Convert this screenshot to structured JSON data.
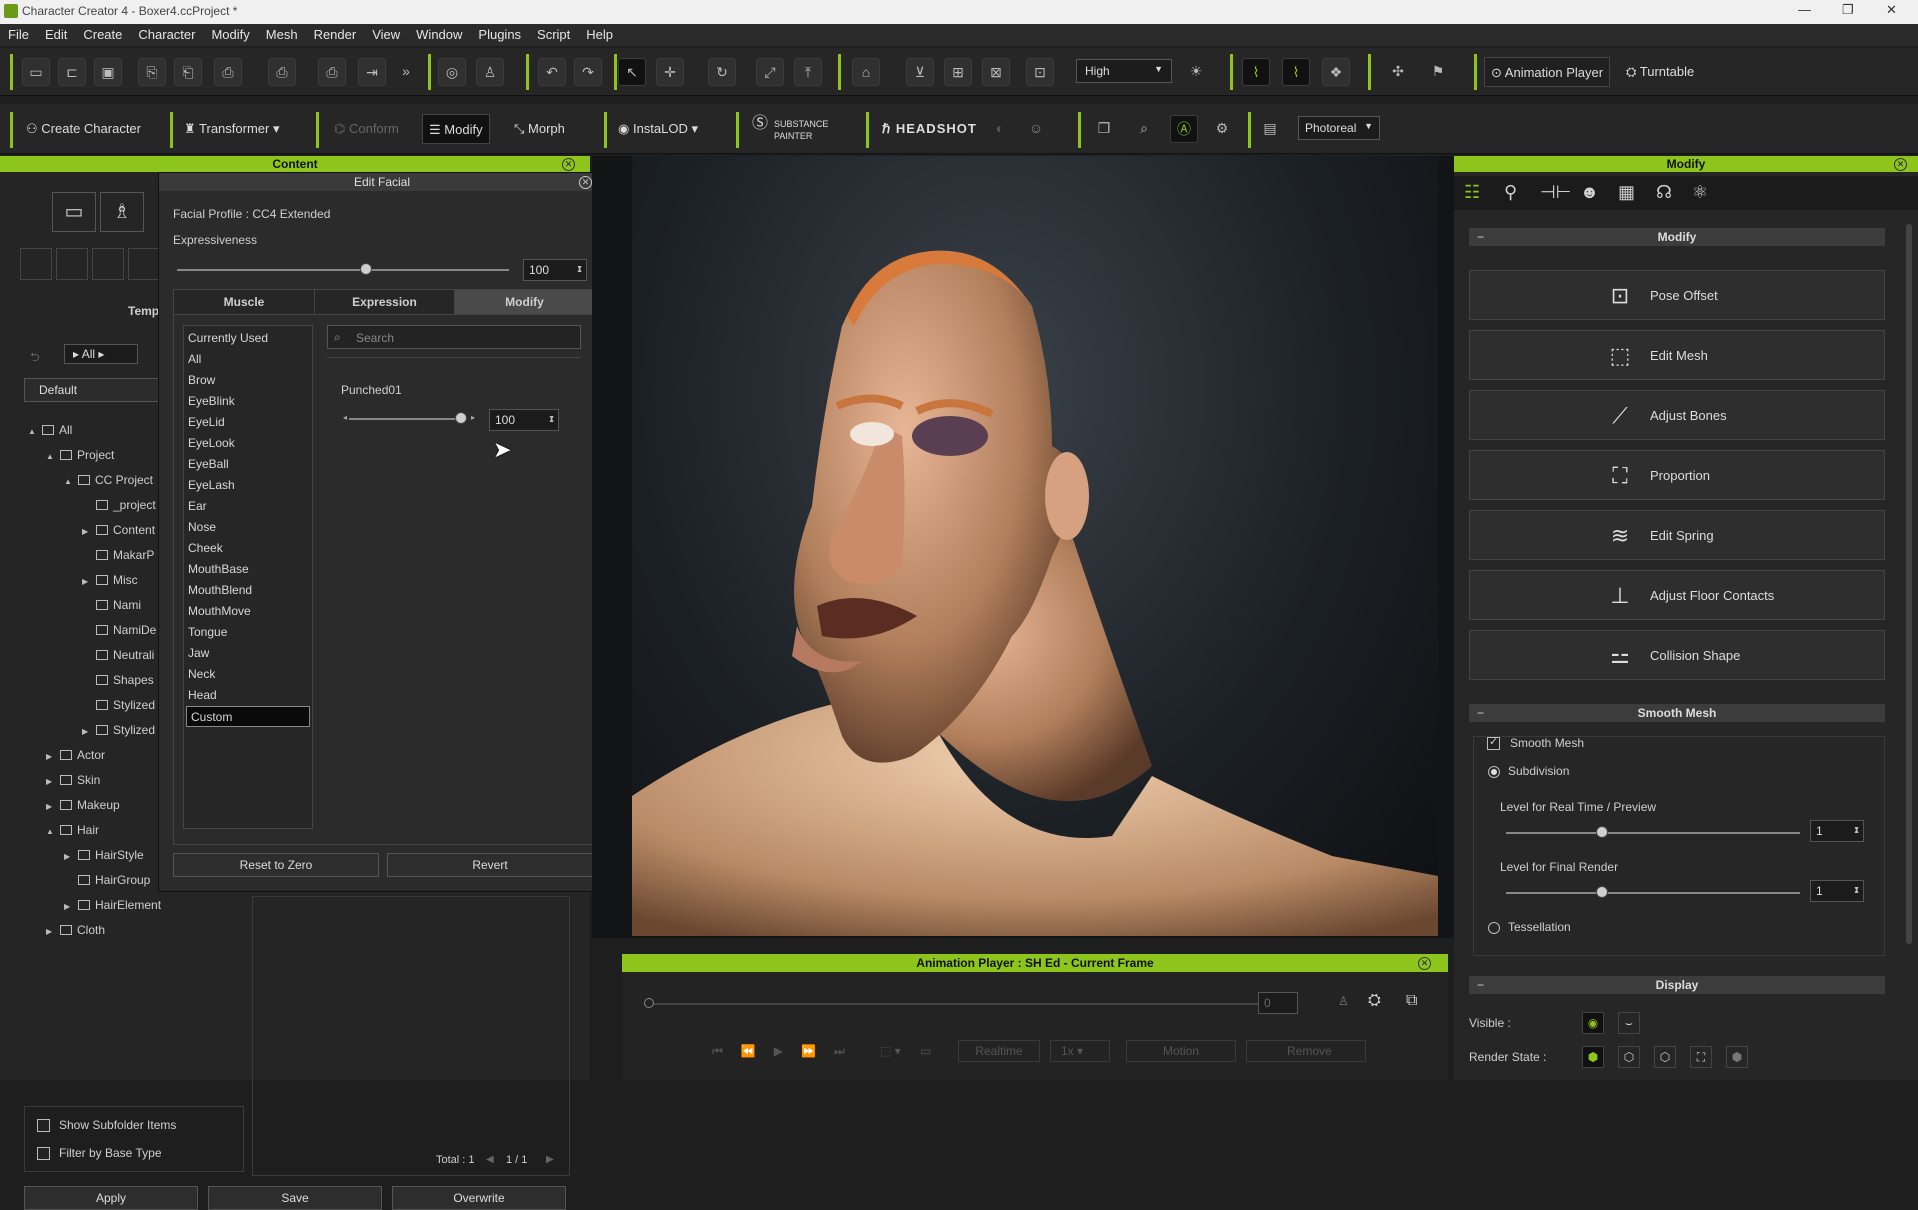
{
  "window": {
    "title": "Character Creator 4 - Boxer4.ccProject *"
  },
  "menu": [
    "File",
    "Edit",
    "Create",
    "Character",
    "Modify",
    "Mesh",
    "Render",
    "View",
    "Window",
    "Plugins",
    "Script",
    "Help"
  ],
  "toolbar": {
    "quality": "High",
    "animation_player": "Animation Player",
    "turntable": "Turntable"
  },
  "toolbar2": {
    "create_character": "Create Character",
    "transformer": "Transformer",
    "conform": "Conform",
    "modify": "Modify",
    "morph": "Morph",
    "instalod": "InstaLOD",
    "substance": "SUBSTANCE PAINTER",
    "headshot": "HEADSHOT",
    "render_mode": "Photoreal"
  },
  "content": {
    "title": "Content",
    "template_tab": "Temp",
    "filter_all": "All",
    "default_label": "Default",
    "tree": [
      {
        "label": "All",
        "depth": 0,
        "arrow": "▲"
      },
      {
        "label": "Project",
        "depth": 1,
        "arrow": "▲"
      },
      {
        "label": "CC Project",
        "depth": 2,
        "arrow": "▲"
      },
      {
        "label": "_project",
        "depth": 3,
        "arrow": ""
      },
      {
        "label": "Content",
        "depth": 3,
        "arrow": "▶"
      },
      {
        "label": "MakarP",
        "depth": 3,
        "arrow": ""
      },
      {
        "label": "Misc",
        "depth": 3,
        "arrow": "▶"
      },
      {
        "label": "Nami",
        "depth": 3,
        "arrow": ""
      },
      {
        "label": "NamiDe",
        "depth": 3,
        "arrow": ""
      },
      {
        "label": "Neutrali",
        "depth": 3,
        "arrow": ""
      },
      {
        "label": "Shapes",
        "depth": 3,
        "arrow": ""
      },
      {
        "label": "Stylized",
        "depth": 3,
        "arrow": ""
      },
      {
        "label": "Stylized",
        "depth": 3,
        "arrow": "▶"
      },
      {
        "label": "Actor",
        "depth": 1,
        "arrow": "▶"
      },
      {
        "label": "Skin",
        "depth": 1,
        "arrow": "▶"
      },
      {
        "label": "Makeup",
        "depth": 1,
        "arrow": "▶"
      },
      {
        "label": "Hair",
        "depth": 1,
        "arrow": "▲"
      },
      {
        "label": "HairStyle",
        "depth": 2,
        "arrow": "▶"
      },
      {
        "label": "HairGroup",
        "depth": 2,
        "arrow": ""
      },
      {
        "label": "HairElement",
        "depth": 2,
        "arrow": "▶"
      },
      {
        "label": "Cloth",
        "depth": 1,
        "arrow": "▶"
      }
    ],
    "show_subfolder": "Show Subfolder Items",
    "filter_base": "Filter by Base Type",
    "total": "Total : 1",
    "page": "1 / 1",
    "apply": "Apply",
    "save": "Save",
    "overwrite": "Overwrite"
  },
  "edit_facial": {
    "title": "Edit Facial",
    "profile": "Facial Profile : CC4 Extended",
    "expressiveness_label": "Expressiveness",
    "expressiveness_value": "100",
    "expressiveness_level": 1.0,
    "tabs": [
      "Muscle",
      "Expression",
      "Modify"
    ],
    "categories": [
      "Currently Used",
      "All",
      "Brow",
      "EyeBlink",
      "EyeLid",
      "EyeLook",
      "EyeBall",
      "EyeLash",
      "Ear",
      "Nose",
      "Cheek",
      "MouthBase",
      "MouthBlend",
      "MouthMove",
      "Tongue",
      "Jaw",
      "Neck",
      "Head",
      "Custom"
    ],
    "selected_category": "Custom",
    "search_placeholder": "Search",
    "morph_name": "Punched01",
    "morph_value": "100",
    "morph_level": 1.0,
    "reset": "Reset to Zero",
    "revert": "Revert"
  },
  "animation_player": {
    "title": "Animation Player : SH Ed - Current Frame",
    "frame": "0",
    "realtime": "Realtime",
    "speed": "1x",
    "motion": "Motion",
    "remove": "Remove"
  },
  "modify_panel": {
    "title": "Modify",
    "section": "Modify",
    "buttons": [
      {
        "label": "Pose Offset",
        "icon": "pose-offset-icon",
        "glyph": "⊡"
      },
      {
        "label": "Edit Mesh",
        "icon": "edit-mesh-icon",
        "glyph": "⬚"
      },
      {
        "label": "Adjust Bones",
        "icon": "adjust-bones-icon",
        "glyph": "⟋"
      },
      {
        "label": "Proportion",
        "icon": "proportion-icon",
        "glyph": "⛶"
      },
      {
        "label": "Edit Spring",
        "icon": "edit-spring-icon",
        "glyph": "≋"
      },
      {
        "label": "Adjust Floor Contacts",
        "icon": "floor-contacts-icon",
        "glyph": "⊥"
      },
      {
        "label": "Collision Shape",
        "icon": "collision-shape-icon",
        "glyph": "⚍"
      }
    ],
    "smooth_section": "Smooth Mesh",
    "smooth_mesh": "Smooth Mesh",
    "subdivision": "Subdivision",
    "level_realtime": "Level for Real Time / Preview",
    "level_realtime_value": "1",
    "level_final": "Level for Final Render",
    "level_final_value": "1",
    "tessellation": "Tessellation",
    "display_section": "Display",
    "visible": "Visible :",
    "render_state": "Render State :"
  },
  "colors": {
    "accent": "#8ec51c",
    "panel": "#2a2a2a"
  }
}
